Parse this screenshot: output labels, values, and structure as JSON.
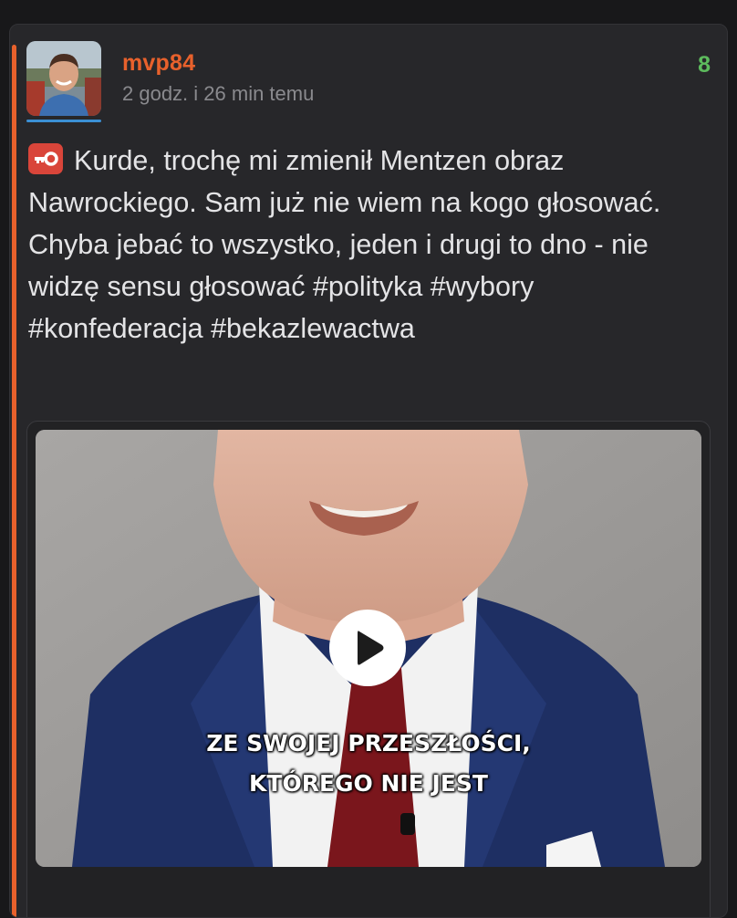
{
  "post": {
    "author": "mvp84",
    "timestamp": "2 godz. i 26 min temu",
    "vote_count": "8",
    "text": "Kurde, trochę mi zmienił Mentzen obraz Nawrockiego. Sam już nie wiem na kogo głosować. Chyba jebać to wszystko, jeden i drugi to dno - nie widzę sensu głosować #polityka #wybory #konfederacja #bekazlewactwa",
    "badge_icon": "key-icon"
  },
  "video": {
    "subtitle_line_1": "ZE SWOJEJ PRZESZŁOŚCI,",
    "subtitle_line_2": "KTÓREGO NIE JEST",
    "play_icon": "play-icon"
  },
  "colors": {
    "accent": "#e8612c",
    "vote": "#5dbb5d",
    "badge": "#d9453a",
    "avatar_underline": "#3b8fd4"
  }
}
